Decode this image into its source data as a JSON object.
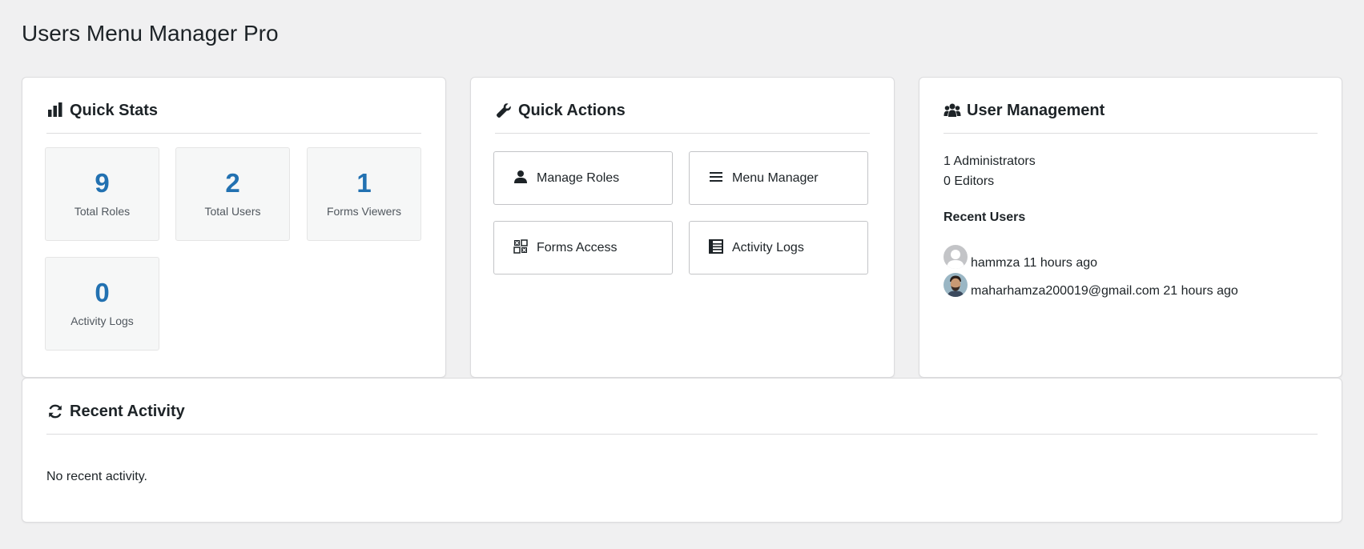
{
  "page": {
    "title": "Users Menu Manager Pro"
  },
  "stats": {
    "title": "Quick Stats",
    "icon": "bar-chart-icon",
    "items": [
      {
        "value": "9",
        "label": "Total Roles"
      },
      {
        "value": "2",
        "label": "Total Users"
      },
      {
        "value": "1",
        "label": "Forms Viewers"
      },
      {
        "value": "0",
        "label": "Activity Logs"
      }
    ]
  },
  "actions": {
    "title": "Quick Actions",
    "icon": "wrench-icon",
    "buttons": [
      {
        "label": "Manage Roles",
        "icon": "person-icon"
      },
      {
        "label": "Menu Manager",
        "icon": "menu-lines-icon"
      },
      {
        "label": "Forms Access",
        "icon": "grid-icon"
      },
      {
        "label": "Activity Logs",
        "icon": "list-table-icon"
      }
    ]
  },
  "users": {
    "title": "User Management",
    "icon": "group-icon",
    "admins": "1 Administrators",
    "editors": "0 Editors",
    "recent_title": "Recent Users",
    "recent": [
      {
        "text": "hammza 11 hours ago",
        "avatar": "default-avatar-icon"
      },
      {
        "text": "maharhamza200019@gmail.com 21 hours ago",
        "avatar": "photo-avatar"
      }
    ]
  },
  "activity": {
    "title": "Recent Activity",
    "icon": "refresh-icon",
    "empty": "No recent activity."
  },
  "colors": {
    "accent": "#2271b1",
    "background": "#f0f0f1",
    "text": "#1d2327"
  }
}
